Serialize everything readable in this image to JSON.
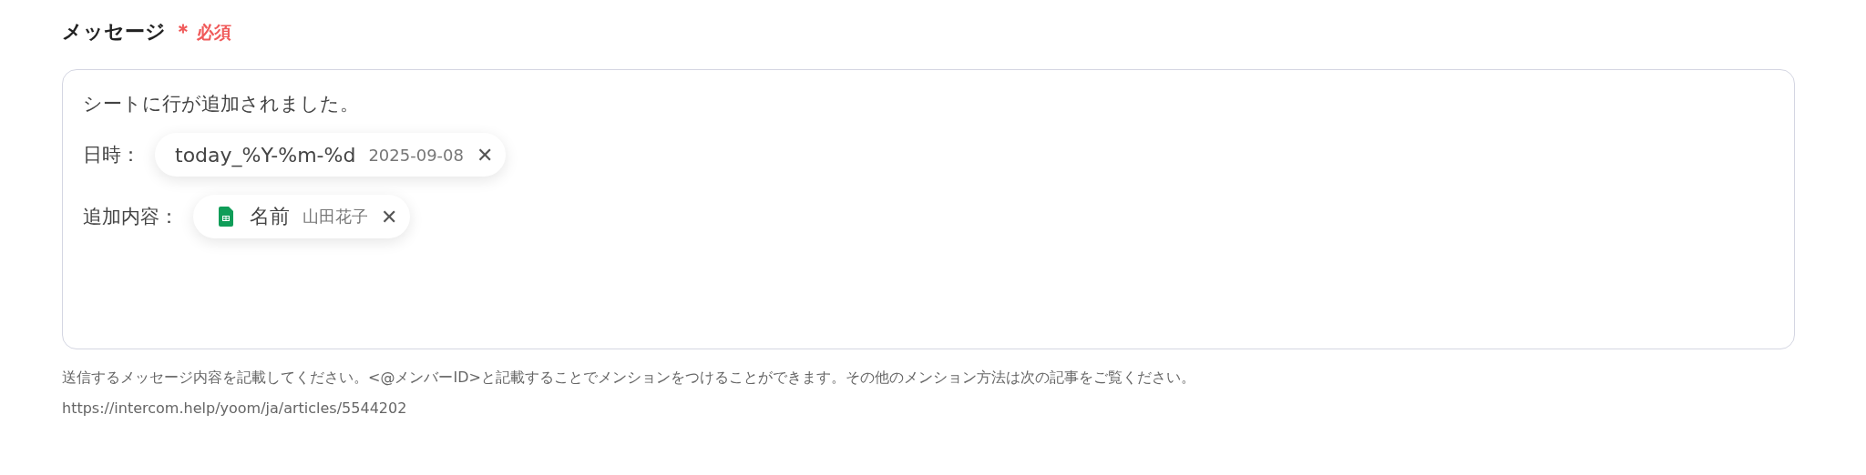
{
  "field": {
    "label": "メッセージ",
    "required_mark": "＊",
    "required_text": "必須"
  },
  "message": {
    "lines": [
      {
        "text": "シートに行が追加されました。"
      },
      {
        "text": "日時：",
        "chip": {
          "kind": "variable",
          "name": "today_%Y-%m-%d",
          "value": "2025-09-08",
          "remove": "✕"
        }
      },
      {
        "text": "追加内容：",
        "chip": {
          "kind": "sheet",
          "name": "名前",
          "value": "山田花子",
          "remove": "✕"
        }
      }
    ]
  },
  "help": {
    "text": "送信するメッセージ内容を記載してください。<@メンバーID>と記載することでメンションをつけることができます。その他のメンション方法は次の記事をご覧ください。",
    "link": "https://intercom.help/yoom/ja/articles/5544202"
  }
}
